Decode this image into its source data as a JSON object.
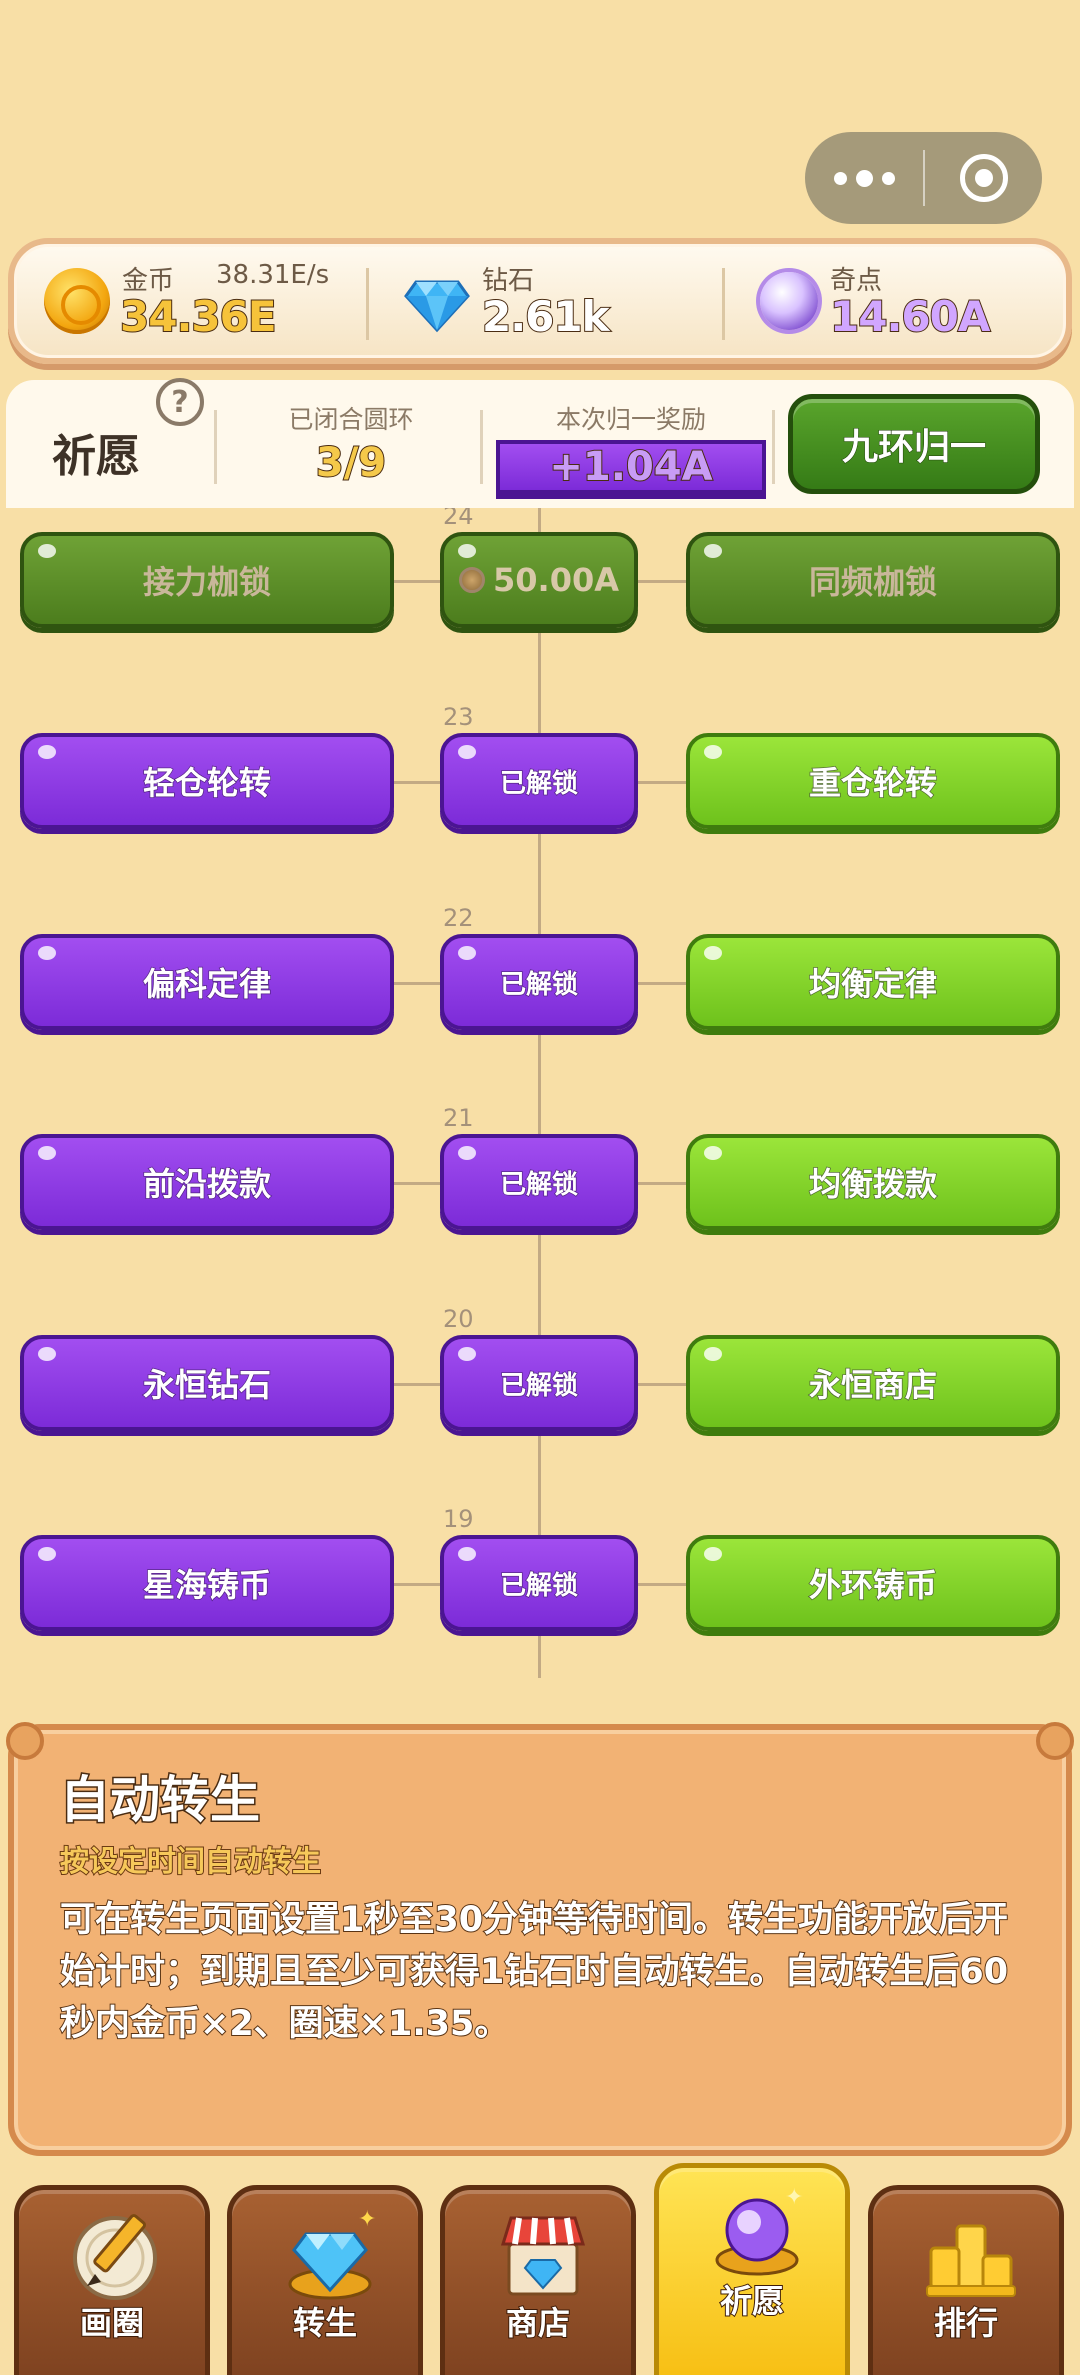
{
  "capsule": {
    "more_label": "•••",
    "close_label": "◎"
  },
  "currency": {
    "gold": {
      "label": "金币",
      "rate": "38.31E/s",
      "value": "34.36E"
    },
    "diamond": {
      "label": "钻石",
      "value": "2.61k"
    },
    "qidian": {
      "label": "奇点",
      "value": "14.60A"
    }
  },
  "wish": {
    "title": "祈愿",
    "help": "?",
    "closed_rings_label": "已闭合圆环",
    "closed_rings_value": "3/9",
    "reward_label": "本次归一奖励",
    "reward_value": "+1.04A",
    "action_label": "九环归一"
  },
  "tree": {
    "rows": [
      {
        "num": "24",
        "left": "接力枷锁",
        "mid": "50.00A",
        "right": "同频枷锁",
        "state": "locked"
      },
      {
        "num": "23",
        "left": "轻仓轮转",
        "mid": "已解锁",
        "right": "重仓轮转",
        "state": "unlocked"
      },
      {
        "num": "22",
        "left": "偏科定律",
        "mid": "已解锁",
        "right": "均衡定律",
        "state": "unlocked"
      },
      {
        "num": "21",
        "left": "前沿拨款",
        "mid": "已解锁",
        "right": "均衡拨款",
        "state": "unlocked"
      },
      {
        "num": "20",
        "left": "永恒钻石",
        "mid": "已解锁",
        "right": "永恒商店",
        "state": "unlocked"
      },
      {
        "num": "19",
        "left": "星海铸币",
        "mid": "已解锁",
        "right": "外环铸币",
        "state": "unlocked"
      }
    ]
  },
  "info": {
    "title": "自动转生",
    "subtitle": "按设定时间自动转生",
    "body": "可在转生页面设置1秒至30分钟等待时间。转生功能开放后开始计时；到期且至少可获得1钻石时自动转生。自动转生后60秒内金币×2、圈速×1.35。"
  },
  "nav": [
    {
      "label": "画圈",
      "icon": "pencil-icon"
    },
    {
      "label": "转生",
      "icon": "crystal-icon"
    },
    {
      "label": "商店",
      "icon": "shop-icon"
    },
    {
      "label": "祈愿",
      "icon": "orb-icon",
      "active": true
    },
    {
      "label": "排行",
      "icon": "podium-icon"
    }
  ],
  "colors": {
    "purple": "#8a35e0",
    "lime": "#7fd126",
    "dark_green": "#4f8a22",
    "background": "#f8dfa6"
  }
}
